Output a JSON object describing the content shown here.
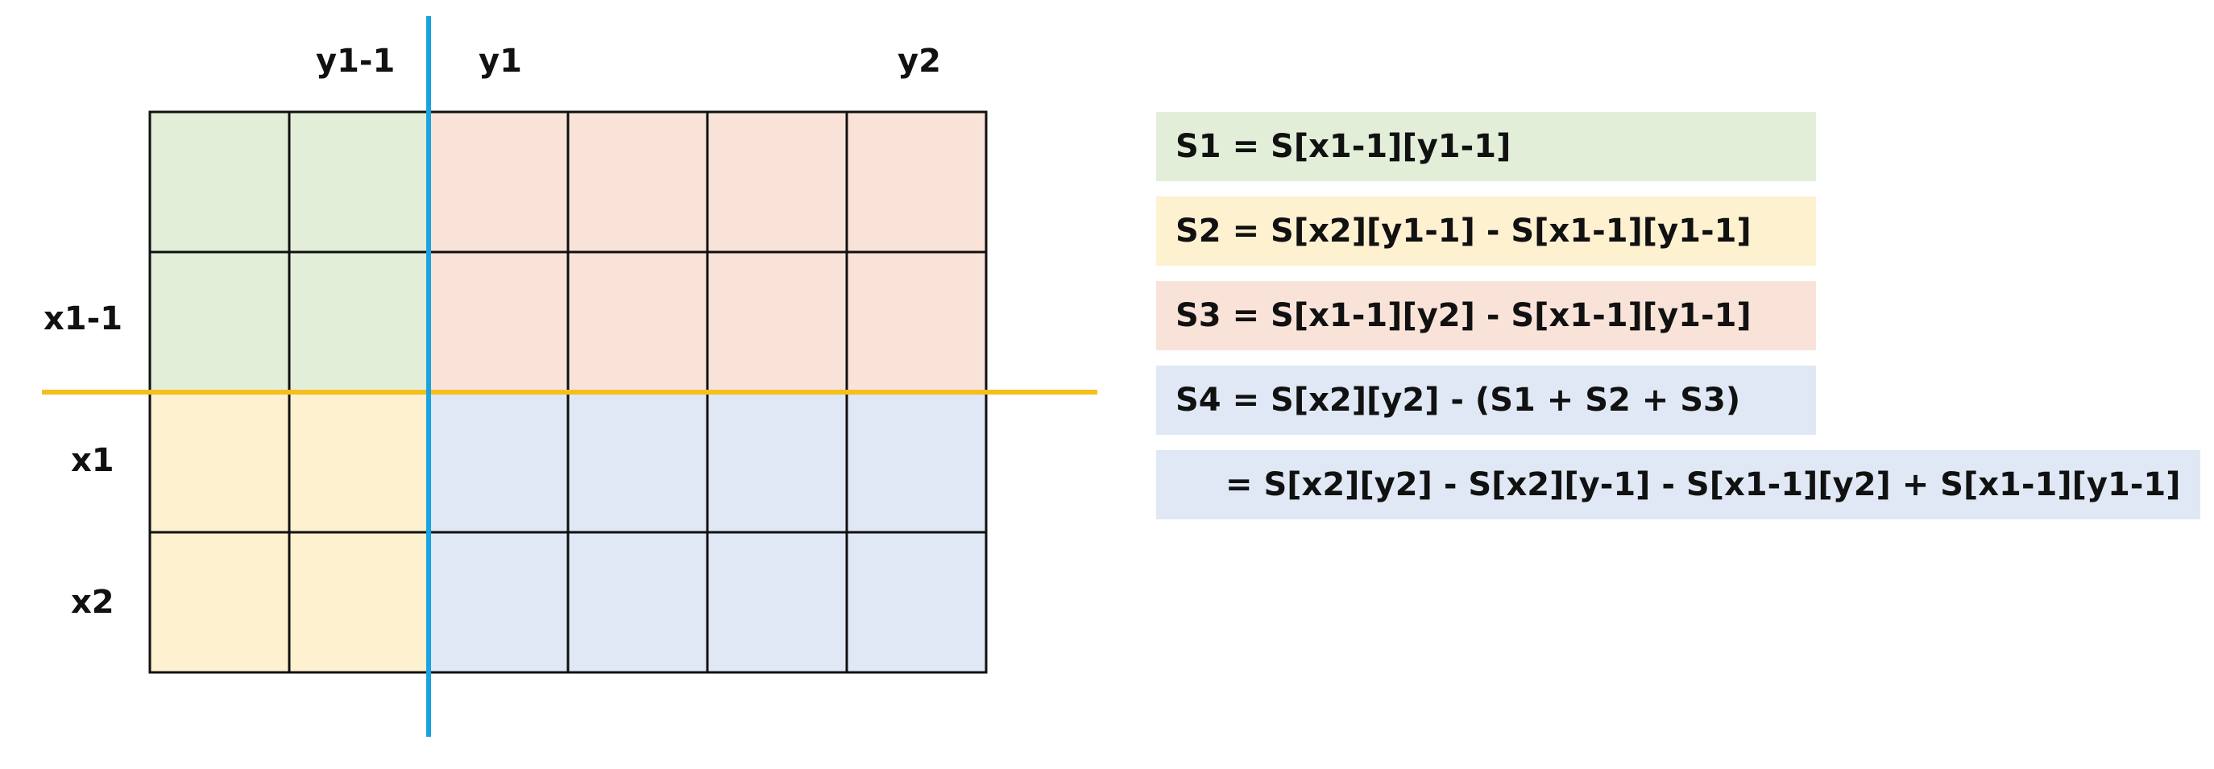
{
  "grid": {
    "rows": 4,
    "cols": 6,
    "row_labels": [
      "",
      "x1-1",
      "x1",
      "x2"
    ],
    "col_labels": [
      "",
      "y1-1",
      "y1",
      "",
      "",
      "y2"
    ],
    "regions": {
      "S1": {
        "rows": [
          0,
          1
        ],
        "cols": [
          0,
          1
        ],
        "color": "#e2eed8"
      },
      "S2": {
        "rows": [
          2,
          3
        ],
        "cols": [
          0,
          1
        ],
        "color": "#fdf1d0"
      },
      "S3": {
        "rows": [
          0,
          1
        ],
        "cols": [
          2,
          5
        ],
        "color": "#f9e3d8"
      },
      "S4": {
        "rows": [
          2,
          3
        ],
        "cols": [
          2,
          5
        ],
        "color": "#dfe8f4"
      }
    },
    "divider_colors": {
      "vertical": "#1aa3e0",
      "horizontal": "#f5bf1c"
    },
    "border_color": "#111111"
  },
  "formulas": [
    {
      "text": "S1 = S[x1-1][y1-1]",
      "color": "#e2eed8"
    },
    {
      "text": "S2 = S[x2][y1-1] - S[x1-1][y1-1]",
      "color": "#fdf1d0"
    },
    {
      "text": "S3 = S[x1-1][y2] - S[x1-1][y1-1]",
      "color": "#f9e3d8"
    },
    {
      "text": "S4 = S[x2][y2] - (S1 + S2 + S3)",
      "color": "#dfe8f4"
    },
    {
      "text": "= S[x2][y2] - S[x2][y-1] - S[x1-1][y2] + S[x1-1][y1-1]",
      "color": "#dfe8f4"
    }
  ]
}
